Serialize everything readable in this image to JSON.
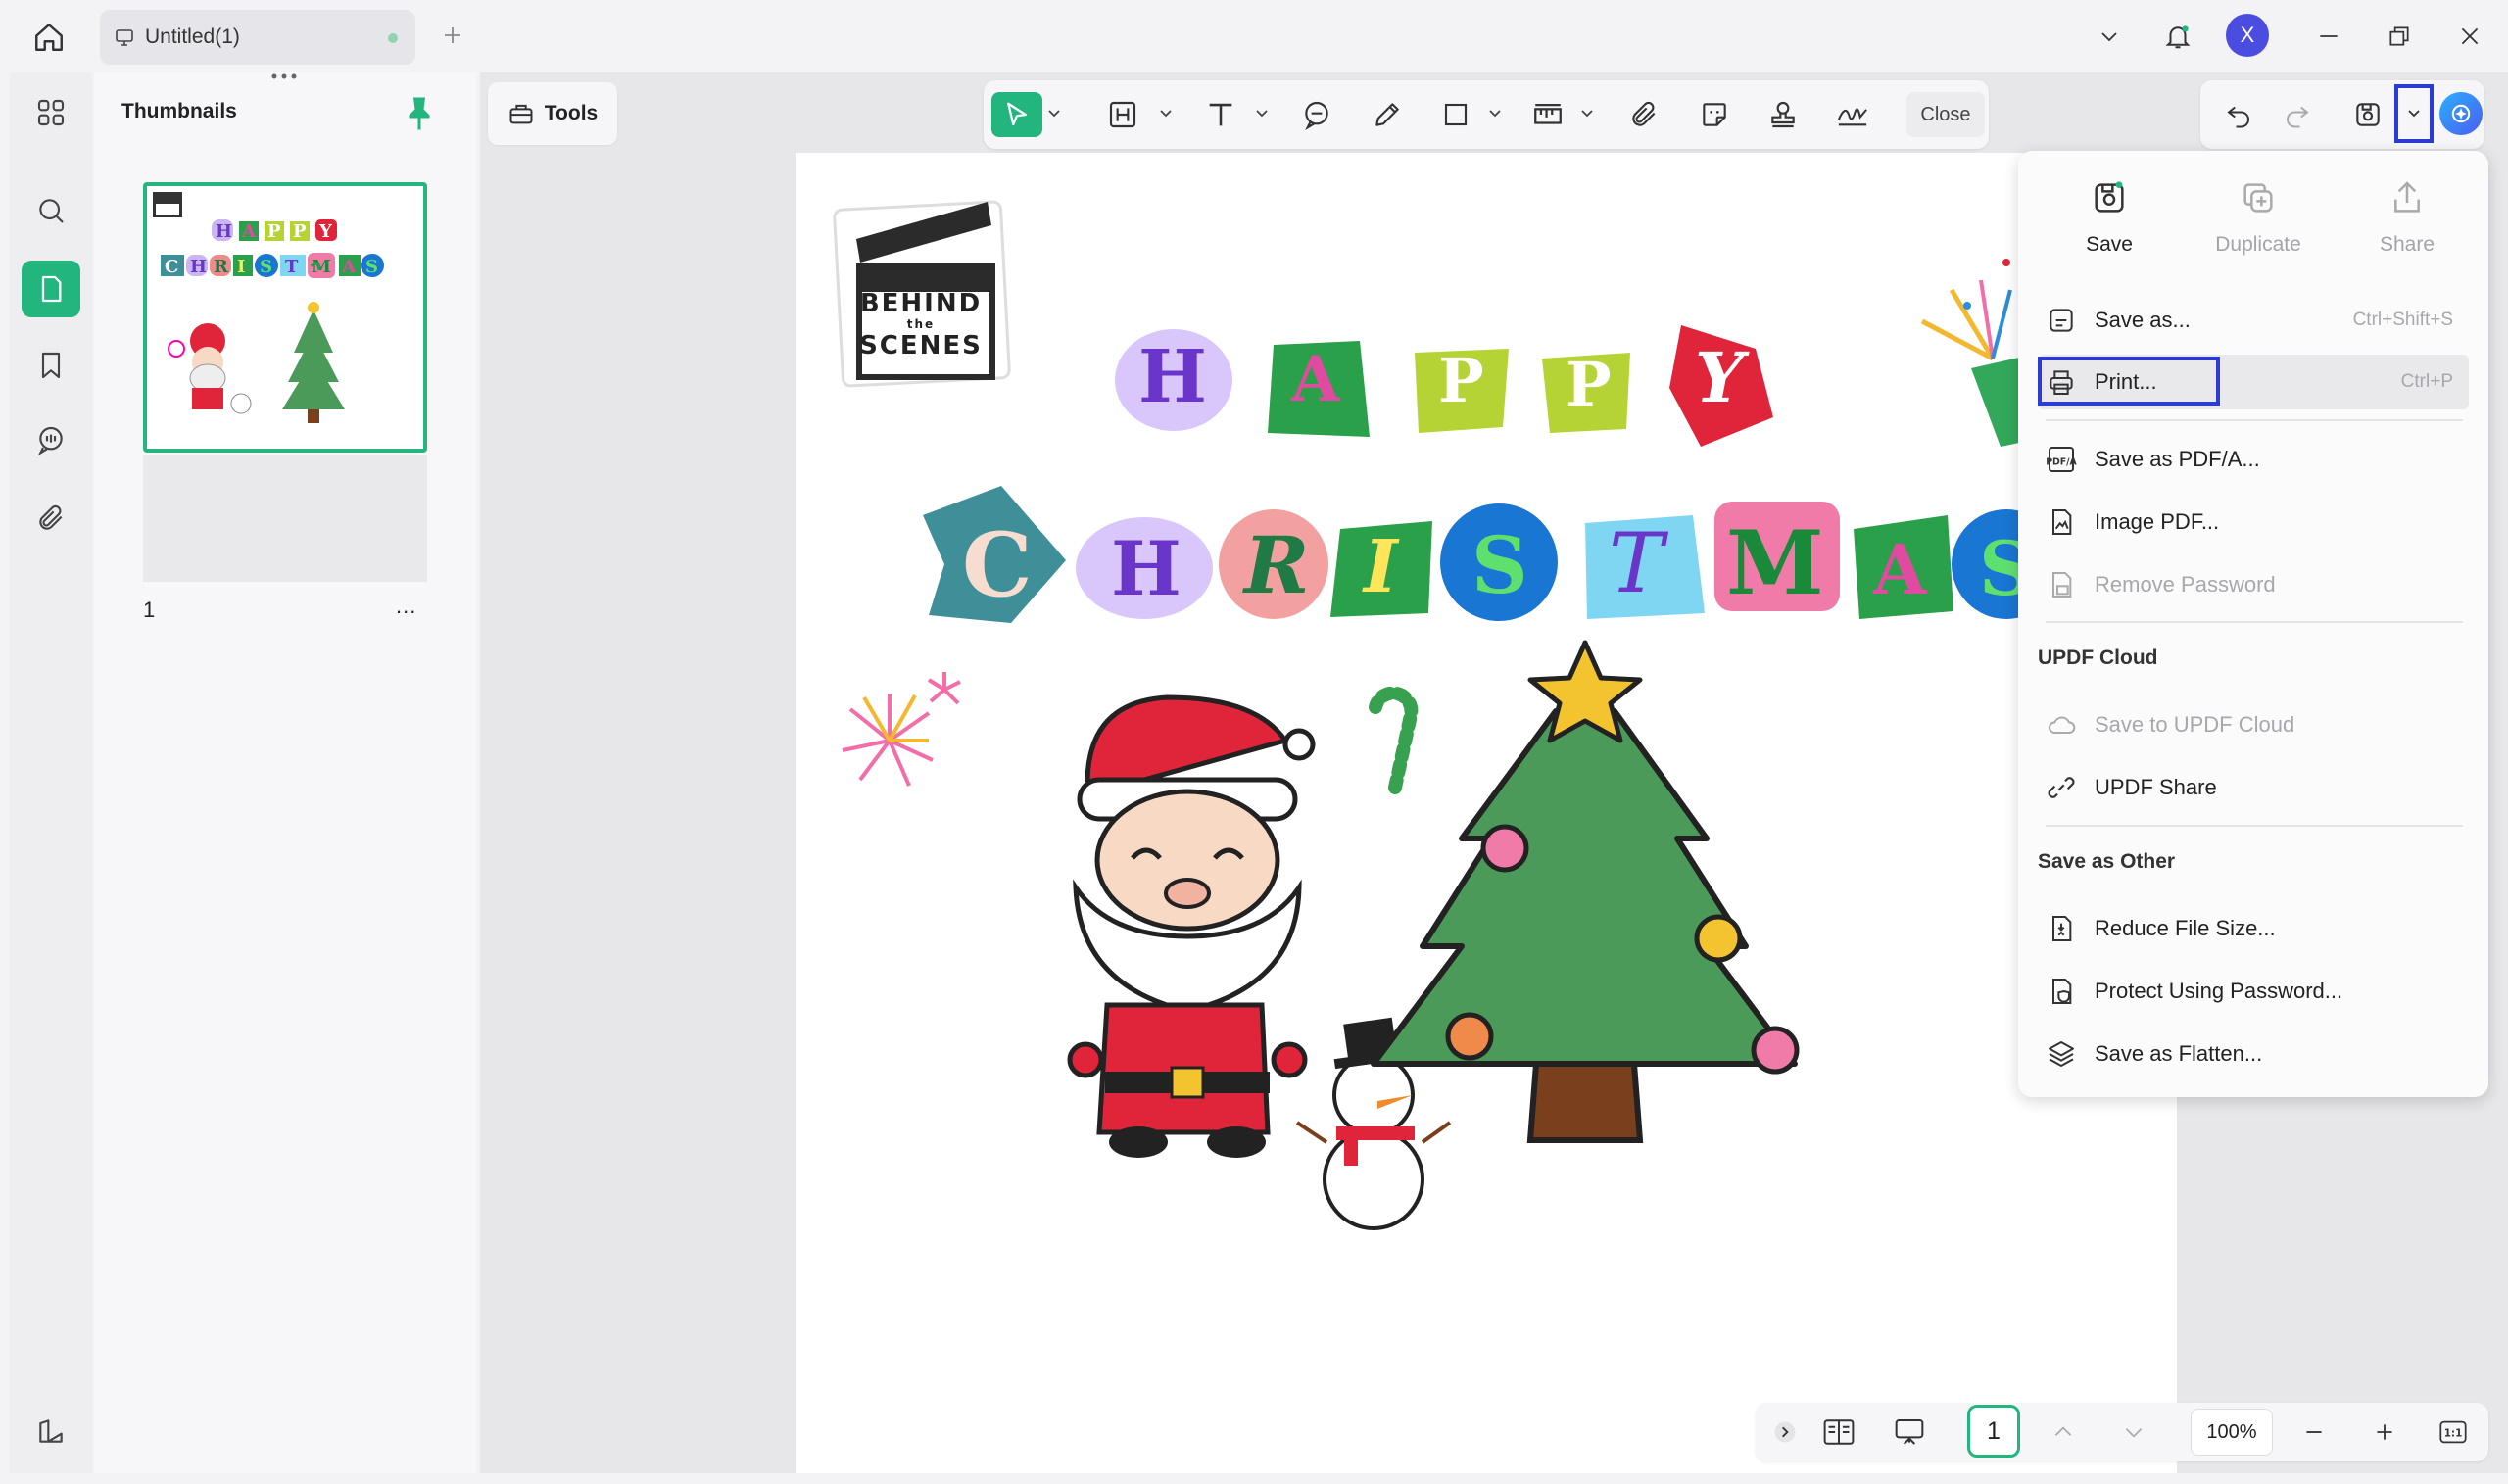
{
  "app": {
    "tab_title": "Untitled(1)",
    "avatar_letter": "X"
  },
  "sidebar": {
    "panel_title": "Thumbnails",
    "page_number": "1",
    "page_more": "...",
    "rail_items": [
      "thumbnails-grid",
      "search",
      "pages",
      "bookmarks",
      "comments",
      "attachments"
    ]
  },
  "toolbar": {
    "tools_label": "Tools",
    "close_label": "Close"
  },
  "document": {
    "logo_lines": [
      "BEHIND",
      "the",
      "SCENES"
    ],
    "row1": [
      "H",
      "A",
      "P",
      "P",
      "Y"
    ],
    "row2": [
      "C",
      "H",
      "R",
      "I",
      "S",
      "T",
      "M",
      "A",
      "S"
    ]
  },
  "menu": {
    "top_actions": [
      {
        "label": "Save",
        "enabled": true
      },
      {
        "label": "Duplicate",
        "enabled": false
      },
      {
        "label": "Share",
        "enabled": false
      }
    ],
    "save_as": {
      "label": "Save as...",
      "shortcut": "Ctrl+Shift+S"
    },
    "print": {
      "label": "Print...",
      "shortcut": "Ctrl+P"
    },
    "save_pdfa": "Save as PDF/A...",
    "image_pdf": "Image PDF...",
    "remove_password": "Remove Password",
    "cloud_header": "UPDF Cloud",
    "save_to_cloud": "Save to UPDF Cloud",
    "updf_share": "UPDF Share",
    "other_header": "Save as Other",
    "reduce_size": "Reduce File Size...",
    "protect_password": "Protect Using Password...",
    "save_flatten": "Save as Flatten..."
  },
  "bottom": {
    "page_value": "1",
    "zoom": "100%"
  },
  "colors": {
    "accent": "#22b67e",
    "highlight": "#2a3bd6",
    "avatar": "#4b4de0"
  }
}
